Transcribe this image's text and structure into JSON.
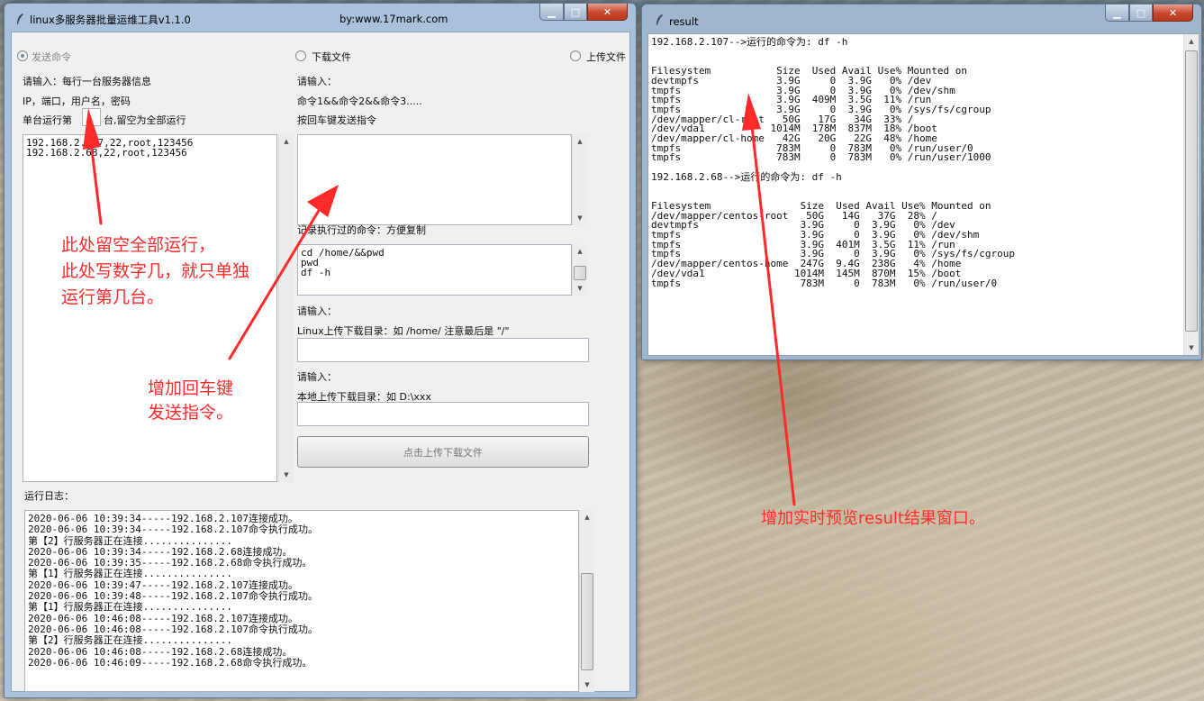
{
  "main_window": {
    "title": "linux多服务器批量运维工具v1.1.0",
    "title_right": "by:www.17mark.com",
    "caption": {
      "minimize": "▁",
      "maximize": "□",
      "close": "✕"
    },
    "radios": {
      "send_cmd": "发送命令",
      "download": "下载文件",
      "upload": "上传文件"
    },
    "left": {
      "prompt": "请输入：每行一台服务器信息",
      "format": "IP，端口，用户名，密码",
      "run_prefix": "单台运行第",
      "run_value": "",
      "run_suffix": "台,留空为全部运行",
      "servers_text": "192.168.2.107,22,root,123456\n192.168.2.68,22,root,123456"
    },
    "middle": {
      "prompt": "请输入：",
      "cmd_format": "命令1&&命令2&&命令3.....",
      "enter_hint": "按回车键发送指令",
      "cmd_input": "",
      "history_label": "记录执行过的命令：方便复制",
      "history_text": "cd /home/&&pwd\npwd\ndf -h",
      "linux_prompt": "请输入：",
      "linux_dir_label": "Linux上传下载目录：如 /home/ 注意最后是 \"/\"",
      "linux_dir_value": "",
      "local_prompt": "请输入：",
      "local_dir_label": "本地上传下载目录：如 D:\\xxx",
      "local_dir_value": "",
      "transfer_button": "点击上传下载文件"
    },
    "log": {
      "label": "运行日志：",
      "text": "2020-06-06 10:39:34-----192.168.2.107连接成功。\n2020-06-06 10:39:34-----192.168.2.107命令执行成功。\n第【2】行服务器正在连接...............\n2020-06-06 10:39:34-----192.168.2.68连接成功。\n2020-06-06 10:39:35-----192.168.2.68命令执行成功。\n第【1】行服务器正在连接...............\n2020-06-06 10:39:47-----192.168.2.107连接成功。\n2020-06-06 10:39:48-----192.168.2.107命令执行成功。\n第【1】行服务器正在连接...............\n2020-06-06 10:46:08-----192.168.2.107连接成功。\n2020-06-06 10:46:08-----192.168.2.107命令执行成功。\n第【2】行服务器正在连接...............\n2020-06-06 10:46:08-----192.168.2.68连接成功。\n2020-06-06 10:46:09-----192.168.2.68命令执行成功。"
    }
  },
  "result_window": {
    "title": "result",
    "caption": {
      "minimize": "▁",
      "maximize": "□",
      "close": "✕"
    },
    "text": "192.168.2.107-->运行的命令为: df -h\n\n\nFilesystem           Size  Used Avail Use% Mounted on\ndevtmpfs             3.9G     0  3.9G   0% /dev\ntmpfs                3.9G     0  3.9G   0% /dev/shm\ntmpfs                3.9G  409M  3.5G  11% /run\ntmpfs                3.9G     0  3.9G   0% /sys/fs/cgroup\n/dev/mapper/cl-root   50G   17G   34G  33% /\n/dev/vda1           1014M  178M  837M  18% /boot\n/dev/mapper/cl-home   42G   20G   22G  48% /home\ntmpfs                783M     0  783M   0% /run/user/0\ntmpfs                783M     0  783M   0% /run/user/1000\n\n192.168.2.68-->运行的命令为: df -h\n\n\nFilesystem               Size  Used Avail Use% Mounted on\n/dev/mapper/centos-root   50G   14G   37G  28% /\ndevtmpfs                 3.9G     0  3.9G   0% /dev\ntmpfs                    3.9G     0  3.9G   0% /dev/shm\ntmpfs                    3.9G  401M  3.5G  11% /run\ntmpfs                    3.9G     0  3.9G   0% /sys/fs/cgroup\n/dev/mapper/centos-home  247G  9.4G  238G   4% /home\n/dev/vda1               1014M  145M  870M  15% /boot\ntmpfs                    783M     0  783M   0% /run/user/0"
  },
  "annotations": {
    "blank_run_line1": "此处留空全部运行，",
    "blank_run_line2": "此处写数字几，就只单独",
    "blank_run_line3": "运行第几台。",
    "enter_line1": "增加回车键",
    "enter_line2": "发送指令。",
    "result_preview": "增加实时预览result结果窗口。"
  },
  "colors": {
    "annotation": "#ff2a2a",
    "window_frame": "#a9c1da",
    "client_bg": "#f0f0f0",
    "close_button": "#c8462c"
  }
}
